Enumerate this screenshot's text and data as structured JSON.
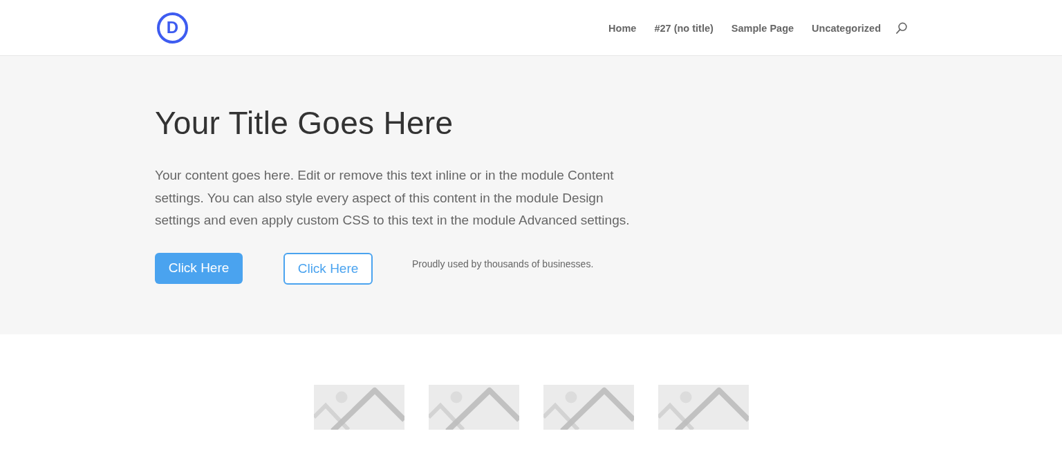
{
  "header": {
    "logo": {
      "text": "D"
    },
    "nav": [
      {
        "label": "Home"
      },
      {
        "label": "#27 (no title)"
      },
      {
        "label": "Sample Page"
      },
      {
        "label": "Uncategorized"
      }
    ]
  },
  "hero": {
    "title": "Your Title Goes Here",
    "body": "Your content goes here. Edit or remove this text inline or in the module Content settings. You can also style every aspect of this content in the module Design settings and even apply custom CSS to this text in the module Advanced settings.",
    "buttons": [
      {
        "label": "Click Here",
        "kind": "filled"
      },
      {
        "label": "Click Here",
        "kind": "outline"
      }
    ],
    "note": "Proudly used by thousands of businesses."
  },
  "gallery": [
    {
      "kind": "image-placeholder"
    },
    {
      "kind": "image-placeholder"
    },
    {
      "kind": "image-placeholder"
    },
    {
      "kind": "image-placeholder"
    }
  ]
}
